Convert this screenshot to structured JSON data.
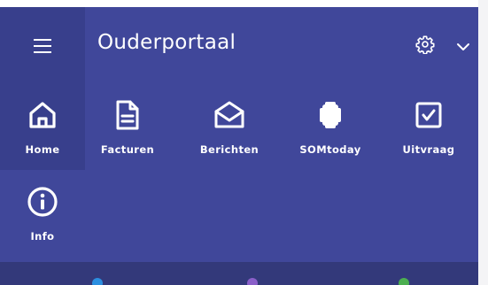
{
  "header": {
    "title": "Ouderportaal",
    "menu_icon": "hamburger-menu-icon",
    "settings_icon": "gear-icon",
    "dropdown_icon": "chevron-down-icon"
  },
  "tiles": [
    {
      "label": "Home",
      "icon": "home-icon",
      "active": true
    },
    {
      "label": "Facturen",
      "icon": "document-icon",
      "active": false
    },
    {
      "label": "Berichten",
      "icon": "envelope-icon",
      "active": false
    },
    {
      "label": "SOMtoday",
      "icon": "somtoday-logo-icon",
      "active": false
    },
    {
      "label": "Uitvraag",
      "icon": "checkbox-icon",
      "active": false
    },
    {
      "label": "Info",
      "icon": "info-icon",
      "active": false
    }
  ],
  "colors": {
    "background": "#40479a",
    "active_tile": "#383f8c",
    "bottom_bar": "#33397a",
    "text": "#ffffff",
    "peek_blue": "#2b8fe0",
    "peek_purple": "#8a5fc9",
    "peek_green": "#4caf50"
  }
}
